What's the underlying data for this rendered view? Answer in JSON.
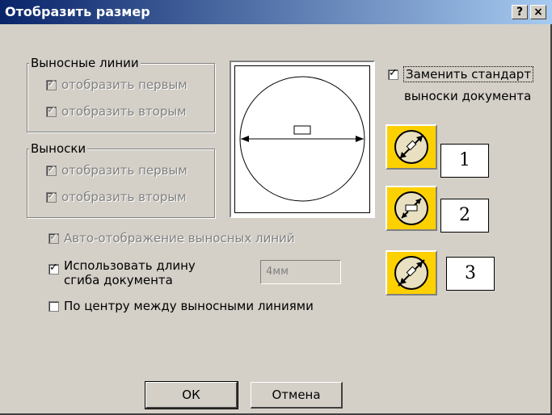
{
  "window": {
    "title": "Отобразить размер",
    "help": "?",
    "close": "×"
  },
  "ext_lines": {
    "legend": "Выносные линии",
    "first": "отобразить первым",
    "second": "отобразить вторым"
  },
  "arrows": {
    "legend": "Выноски",
    "first": "отобразить первым",
    "second": "отобразить вторым"
  },
  "options": {
    "auto": "Авто-отображение выносных линий",
    "use_length_l1": "Использовать длину",
    "use_length_l2": "сгиба документа",
    "length_value": "4мм",
    "center": "По центру между выносными линиями"
  },
  "replace": {
    "label": "Заменить стандарт",
    "label2": "выноски документа"
  },
  "callouts": [
    "1",
    "2",
    "3"
  ],
  "buttons": {
    "ok": "ОК",
    "cancel": "Отмена"
  },
  "icons": [
    "diameter-icon-arrows-inside",
    "diameter-icon-arrows-outside",
    "diameter-icon-slashed"
  ],
  "colors": {
    "titlebar_start": "#0a246a",
    "titlebar_end": "#a6caf0",
    "icon_bg": "#fdd000",
    "dialog_bg": "#d4d0c8"
  }
}
